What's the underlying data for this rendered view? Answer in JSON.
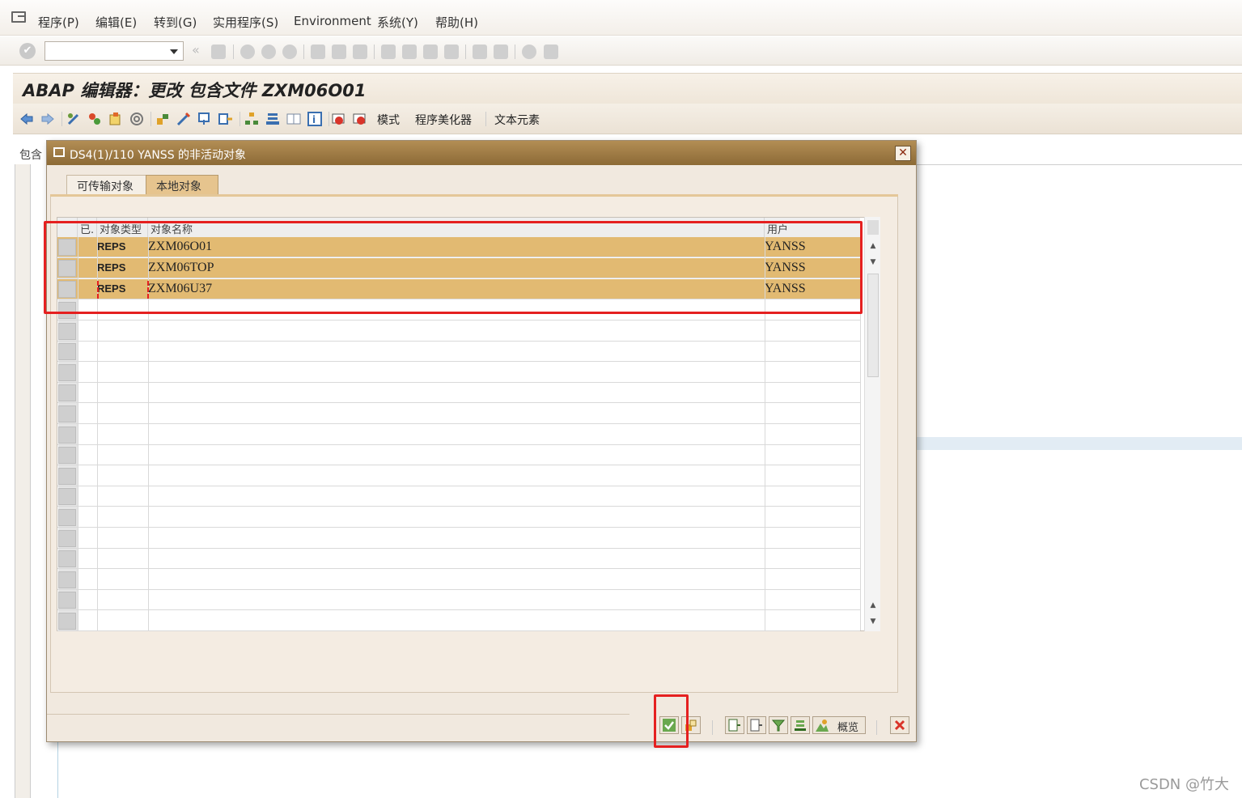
{
  "menubar": {
    "items": [
      "程序(P)",
      "编辑(E)",
      "转到(G)",
      "实用程序(S)",
      "Environment",
      "系统(Y)",
      "帮助(H)"
    ]
  },
  "title": "ABAP 编辑器：更改 包含文件 ZXM06O01",
  "app_toolbar": {
    "text_buttons": [
      "模式",
      "程序美化器",
      "文本元素"
    ]
  },
  "background_label": "包含",
  "dialog": {
    "title": "DS4(1)/110 YANSS 的非活动对象",
    "tabs": [
      "可传输对象",
      "本地对象"
    ],
    "active_tab": "本地对象",
    "table": {
      "headers": [
        "已.",
        "对象类型",
        "对象名称",
        "用户"
      ],
      "rows": [
        {
          "type": "REPS",
          "name": "ZXM06O01",
          "user": "YANSS"
        },
        {
          "type": "REPS",
          "name": "ZXM06TOP",
          "user": "YANSS"
        },
        {
          "type": "REPS",
          "name": "ZXM06U37",
          "user": "YANSS"
        }
      ]
    },
    "buttons": {
      "overview_label": "概览"
    }
  },
  "watermark": "CSDN @竹大",
  "colors": {
    "selected_row": "#e2ba72",
    "title_bar": "#9b7a44",
    "annotation": "#e52020"
  }
}
